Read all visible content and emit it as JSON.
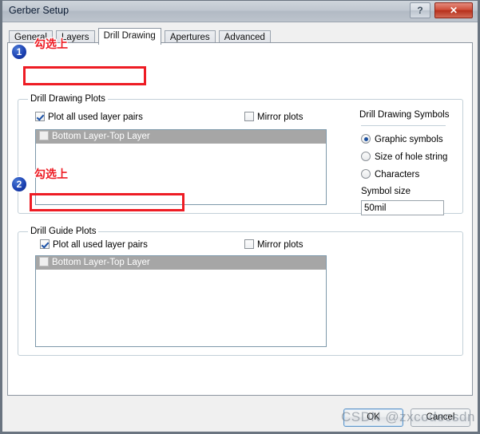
{
  "window": {
    "title": "Gerber Setup",
    "help_label": "?",
    "close_label": "✕"
  },
  "tabs": [
    {
      "label": "General",
      "active": false
    },
    {
      "label": "Layers",
      "active": false
    },
    {
      "label": "Drill Drawing",
      "active": true
    },
    {
      "label": "Apertures",
      "active": false
    },
    {
      "label": "Advanced",
      "active": false
    }
  ],
  "drill_drawing_plots": {
    "group_title": "Drill Drawing Plots",
    "plot_all_label": "Plot all used layer pairs",
    "plot_all_checked": true,
    "mirror_label": "Mirror plots",
    "mirror_checked": false,
    "list_items": [
      {
        "label": "Bottom Layer-Top Layer",
        "checked": false
      }
    ]
  },
  "drill_guide_plots": {
    "group_title": "Drill Guide Plots",
    "plot_all_label": "Plot all used layer pairs",
    "plot_all_checked": true,
    "mirror_label": "Mirror plots",
    "mirror_checked": false,
    "list_items": [
      {
        "label": "Bottom Layer-Top Layer",
        "checked": false
      }
    ]
  },
  "drill_drawing_symbols": {
    "title": "Drill Drawing Symbols",
    "options": [
      {
        "label": "Graphic symbols",
        "selected": true
      },
      {
        "label": "Size of hole string",
        "selected": false
      },
      {
        "label": "Characters",
        "selected": false
      }
    ],
    "symbol_size_label": "Symbol size",
    "symbol_size_value": "50mil",
    "symbol_size_placeholder": "50mil"
  },
  "footer": {
    "ok_label": "OK",
    "cancel_label": "Cancel"
  },
  "annotations": [
    {
      "number": "1",
      "text": "勾选上"
    },
    {
      "number": "2",
      "text": "勾选上"
    }
  ],
  "watermark": {
    "text": "CSDN @zxcodecsdn"
  },
  "colors": {
    "annotation_red": "#ee1c24",
    "annotation_blue": "#1a3fb0",
    "close_red": "#b6301c",
    "radio_accent": "#1b4f9e",
    "check_accent": "#1c52a8",
    "list_selection_gray": "#a6a6a6"
  }
}
